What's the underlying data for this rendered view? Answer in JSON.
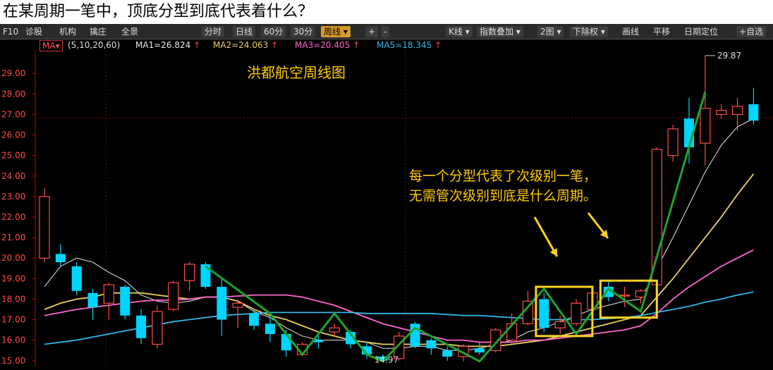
{
  "question": "在某周期一笔中，顶底分型到底代表着什么？",
  "toolbar": {
    "f10": "F10",
    "left_items": [
      "诊股",
      "机构",
      "擒庄",
      "全景"
    ],
    "period_tabs": [
      "分时",
      "日线",
      "60分",
      "30分"
    ],
    "active_period": "周线",
    "zoom_in": "+",
    "zoom_out": "-",
    "right_items": [
      "K线",
      "指数叠加",
      "2图",
      "下除权",
      "画线",
      "平移",
      "日期定位",
      "自选"
    ],
    "colors": {
      "active": "#d69a2a"
    }
  },
  "indicator_bar": {
    "selector": "MA",
    "params": "(5,10,20,60)",
    "ma1": "MA1=26.824",
    "ma2": "MA2=24.063",
    "ma3": "MA3=20.405",
    "ma5": "MA5=18.345",
    "arrow": "↑"
  },
  "chart_data": {
    "type": "candlestick",
    "title": "洪都航空周线图",
    "annotation": "每一个分型代表了次级别一笔，\n无需管次级别到底是什么周期。",
    "ylim": [
      14.82,
      29.9
    ],
    "y_ticks": [
      29.0,
      28.0,
      27.0,
      26.0,
      25.0,
      24.0,
      23.0,
      22.0,
      21.0,
      20.0,
      19.0,
      18.0,
      17.0,
      16.0,
      15.0
    ],
    "max_label": "29.87",
    "min_label": "14.97",
    "candles": [
      {
        "o": 20.0,
        "h": 23.4,
        "l": 19.8,
        "c": 23.0
      },
      {
        "o": 20.2,
        "h": 20.7,
        "l": 19.6,
        "c": 19.8
      },
      {
        "o": 19.6,
        "h": 19.8,
        "l": 18.2,
        "c": 18.4
      },
      {
        "o": 18.3,
        "h": 18.5,
        "l": 17.0,
        "c": 17.6
      },
      {
        "o": 17.8,
        "h": 18.8,
        "l": 17.0,
        "c": 18.7
      },
      {
        "o": 18.6,
        "h": 18.7,
        "l": 17.0,
        "c": 17.2
      },
      {
        "o": 17.2,
        "h": 17.5,
        "l": 15.8,
        "c": 16.1
      },
      {
        "o": 15.8,
        "h": 17.7,
        "l": 15.6,
        "c": 17.4
      },
      {
        "o": 17.5,
        "h": 18.9,
        "l": 17.4,
        "c": 18.8
      },
      {
        "o": 18.9,
        "h": 19.8,
        "l": 18.4,
        "c": 19.7
      },
      {
        "o": 19.7,
        "h": 19.8,
        "l": 18.5,
        "c": 18.6
      },
      {
        "o": 18.6,
        "h": 19.0,
        "l": 16.2,
        "c": 17.0
      },
      {
        "o": 17.6,
        "h": 18.0,
        "l": 16.6,
        "c": 17.8
      },
      {
        "o": 17.3,
        "h": 17.5,
        "l": 16.5,
        "c": 16.7
      },
      {
        "o": 16.8,
        "h": 17.2,
        "l": 15.9,
        "c": 16.3
      },
      {
        "o": 16.3,
        "h": 16.5,
        "l": 15.2,
        "c": 15.5
      },
      {
        "o": 15.3,
        "h": 15.9,
        "l": 15.2,
        "c": 15.8
      },
      {
        "o": 16.0,
        "h": 16.2,
        "l": 15.6,
        "c": 15.9
      },
      {
        "o": 16.4,
        "h": 16.8,
        "l": 16.2,
        "c": 16.6
      },
      {
        "o": 16.4,
        "h": 16.5,
        "l": 15.6,
        "c": 15.8
      },
      {
        "o": 15.7,
        "h": 15.9,
        "l": 15.1,
        "c": 15.3
      },
      {
        "o": 15.2,
        "h": 15.3,
        "l": 14.97,
        "c": 15.0
      },
      {
        "o": 15.1,
        "h": 16.4,
        "l": 15.0,
        "c": 16.2
      },
      {
        "o": 16.8,
        "h": 16.9,
        "l": 15.6,
        "c": 15.7
      },
      {
        "o": 16.0,
        "h": 16.1,
        "l": 15.3,
        "c": 15.6
      },
      {
        "o": 15.5,
        "h": 15.7,
        "l": 15.0,
        "c": 15.2
      },
      {
        "o": 15.2,
        "h": 15.8,
        "l": 14.97,
        "c": 15.7
      },
      {
        "o": 15.6,
        "h": 15.9,
        "l": 15.3,
        "c": 15.4
      },
      {
        "o": 15.5,
        "h": 16.6,
        "l": 15.4,
        "c": 16.5
      },
      {
        "o": 16.0,
        "h": 17.3,
        "l": 15.9,
        "c": 16.8
      },
      {
        "o": 16.8,
        "h": 18.4,
        "l": 16.7,
        "c": 17.9
      },
      {
        "o": 18.0,
        "h": 18.3,
        "l": 16.4,
        "c": 16.6
      },
      {
        "o": 16.6,
        "h": 17.2,
        "l": 16.3,
        "c": 16.9
      },
      {
        "o": 16.8,
        "h": 18.0,
        "l": 16.7,
        "c": 17.8
      },
      {
        "o": 17.5,
        "h": 18.5,
        "l": 17.4,
        "c": 18.3
      },
      {
        "o": 18.6,
        "h": 18.9,
        "l": 17.9,
        "c": 18.1
      },
      {
        "o": 18.2,
        "h": 18.6,
        "l": 17.6,
        "c": 18.2
      },
      {
        "o": 18.1,
        "h": 18.5,
        "l": 17.8,
        "c": 18.4
      },
      {
        "o": 18.7,
        "h": 25.4,
        "l": 18.6,
        "c": 25.3
      },
      {
        "o": 25.0,
        "h": 26.5,
        "l": 24.7,
        "c": 26.3
      },
      {
        "o": 26.8,
        "h": 27.8,
        "l": 24.6,
        "c": 25.4
      },
      {
        "o": 25.6,
        "h": 29.87,
        "l": 24.5,
        "c": 27.3
      },
      {
        "o": 27.0,
        "h": 27.5,
        "l": 26.8,
        "c": 27.2
      },
      {
        "o": 27.0,
        "h": 27.8,
        "l": 26.2,
        "c": 27.4
      },
      {
        "o": 27.5,
        "h": 28.3,
        "l": 26.5,
        "c": 26.7
      }
    ],
    "ma_series": [
      {
        "name": "MA1",
        "color": "#e8e8e8",
        "values": [
          18.6,
          19.6,
          20.0,
          19.8,
          19.3,
          18.9,
          18.2,
          17.9,
          17.8,
          17.9,
          18.1,
          18.1,
          17.9,
          17.4,
          17.1,
          16.6,
          16.2,
          16.0,
          16.0,
          16.0,
          15.9,
          15.6,
          15.6,
          15.7,
          15.7,
          15.5,
          15.5,
          15.6,
          15.8,
          16.0,
          16.4,
          16.6,
          16.9,
          17.2,
          17.5,
          17.7,
          17.9,
          18.0,
          19.5,
          21.0,
          22.6,
          24.2,
          25.5,
          26.4,
          26.8
        ]
      },
      {
        "name": "MA2",
        "color": "#e8d060",
        "values": [
          17.5,
          17.8,
          18.0,
          18.1,
          18.3,
          18.3,
          18.3,
          18.2,
          18.1,
          18.0,
          18.1,
          18.1,
          17.9,
          17.5,
          17.2,
          17.0,
          16.7,
          16.4,
          16.2,
          16.0,
          15.9,
          15.8,
          15.8,
          15.8,
          15.8,
          15.8,
          15.7,
          15.7,
          15.7,
          15.8,
          15.9,
          16.0,
          16.2,
          16.4,
          16.6,
          16.8,
          17.0,
          17.2,
          18.1,
          19.0,
          20.0,
          21.0,
          22.0,
          23.1,
          24.1
        ]
      },
      {
        "name": "MA3",
        "color": "#ff66cc",
        "values": [
          17.2,
          17.35,
          17.5,
          17.6,
          17.7,
          17.8,
          17.9,
          17.95,
          17.95,
          18.0,
          18.1,
          18.1,
          18.15,
          18.2,
          18.2,
          18.2,
          18.1,
          17.9,
          17.7,
          17.4,
          17.1,
          16.8,
          16.6,
          16.4,
          16.2,
          16.0,
          16.0,
          15.9,
          15.9,
          15.9,
          16.0,
          16.0,
          16.1,
          16.2,
          16.3,
          16.4,
          16.5,
          16.7,
          17.3,
          18.0,
          18.6,
          19.1,
          19.6,
          20.0,
          20.4
        ]
      },
      {
        "name": "MA5",
        "color": "#33b8e8",
        "values": [
          15.8,
          15.9,
          16.0,
          16.15,
          16.3,
          16.45,
          16.6,
          16.75,
          16.9,
          17.0,
          17.1,
          17.2,
          17.25,
          17.3,
          17.35,
          17.35,
          17.35,
          17.35,
          17.35,
          17.35,
          17.3,
          17.3,
          17.3,
          17.3,
          17.3,
          17.25,
          17.2,
          17.2,
          17.15,
          17.1,
          17.05,
          17.0,
          17.0,
          17.0,
          17.0,
          17.05,
          17.1,
          17.2,
          17.35,
          17.5,
          17.65,
          17.85,
          18.0,
          18.2,
          18.35
        ]
      }
    ],
    "strokes": {
      "color": "#1fa32e",
      "points": [
        [
          10,
          19.6
        ],
        [
          14,
          17.3
        ],
        [
          16,
          15.3
        ],
        [
          18,
          17.3
        ],
        [
          20,
          15.3
        ],
        [
          21,
          14.97
        ],
        [
          23,
          16.6
        ],
        [
          27,
          14.97
        ],
        [
          31,
          18.5
        ],
        [
          33,
          16.3
        ],
        [
          35,
          18.5
        ],
        [
          37,
          17.4
        ],
        [
          41,
          28.1
        ]
      ]
    },
    "boxes": [
      {
        "x0": 30.5,
        "x1": 34,
        "y0": 16.2,
        "y1": 18.6
      },
      {
        "x0": 34.5,
        "x1": 38,
        "y0": 17.1,
        "y1": 18.9
      }
    ],
    "colors": {
      "up": "#ff4a4a",
      "down": "#00d4ff",
      "grid": "#7a0000",
      "axis": "#cc0000",
      "text": "#ffcc00",
      "box": "#ffd21f"
    }
  }
}
